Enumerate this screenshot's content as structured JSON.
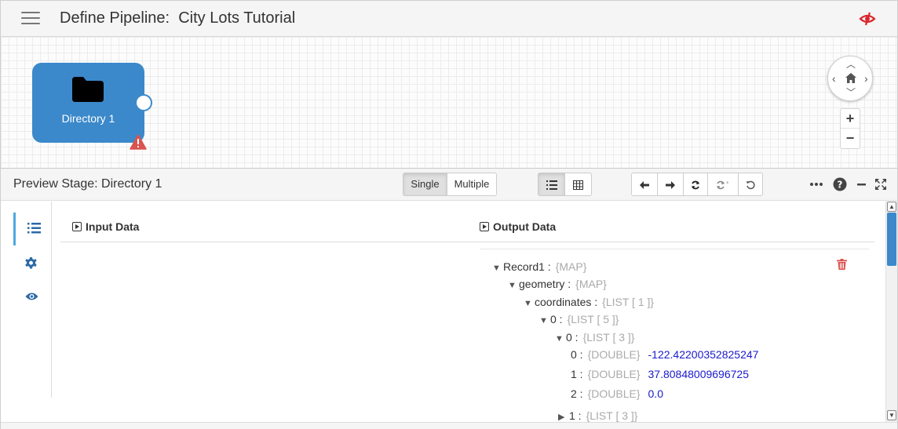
{
  "header": {
    "title": "Define Pipeline:  City Lots Tutorial",
    "menu_icon": "hamburger-icon",
    "logo_icon": "streamsets-logo-icon",
    "accent_color": "#d9272e"
  },
  "canvas": {
    "stage": {
      "label": "Directory 1",
      "icon": "folder-icon",
      "color": "#3b89cb",
      "warning": "warning-triangle-icon"
    },
    "nav": {
      "up": "▲",
      "down": "▼",
      "left": "◀",
      "right": "▶",
      "home_icon": "home-icon"
    },
    "zoom": {
      "in": "+",
      "out": "−"
    }
  },
  "preview": {
    "title": "Preview Stage: Directory 1",
    "mode_buttons": {
      "single": "Single",
      "multiple": "Multiple",
      "selected": "Single"
    },
    "view_icons": [
      "list-view-icon",
      "table-view-icon"
    ],
    "step_icons": [
      "step-back-icon",
      "step-forward-icon",
      "refresh-icon",
      "run-with-changes-icon",
      "reset-icon"
    ],
    "window_icons": [
      "more-icon",
      "help-icon",
      "minimize-icon",
      "maximize-icon"
    ],
    "side_tabs": [
      "records-tab-icon",
      "configuration-tab-icon",
      "preview-tab-icon"
    ],
    "input_header": "Input Data",
    "output_header": "Output Data",
    "tree": [
      {
        "toggle": "▼",
        "key": "Record1 :",
        "type": "{MAP}"
      },
      {
        "toggle": "▼",
        "key": "geometry :",
        "type": "{MAP}"
      },
      {
        "toggle": "▼",
        "key": "coordinates :",
        "type": "{LIST [ 1 ]}"
      },
      {
        "toggle": "▼",
        "key": "0 :",
        "type": "{LIST [ 5 ]}"
      },
      {
        "toggle": "▼",
        "key": "0 :",
        "type": "{LIST [ 3 ]}"
      },
      {
        "toggle": "",
        "key": "0 :",
        "type": "{DOUBLE}",
        "value": "-122.42200352825247"
      },
      {
        "toggle": "",
        "key": "1 :",
        "type": "{DOUBLE}",
        "value": "37.80848009696725"
      },
      {
        "toggle": "",
        "key": "2 :",
        "type": "{DOUBLE}",
        "value": "0.0"
      },
      {
        "toggle": "▶",
        "key": "1 :",
        "type": "{LIST [ 3 ]}"
      }
    ],
    "delete_icon": "trash-icon"
  }
}
